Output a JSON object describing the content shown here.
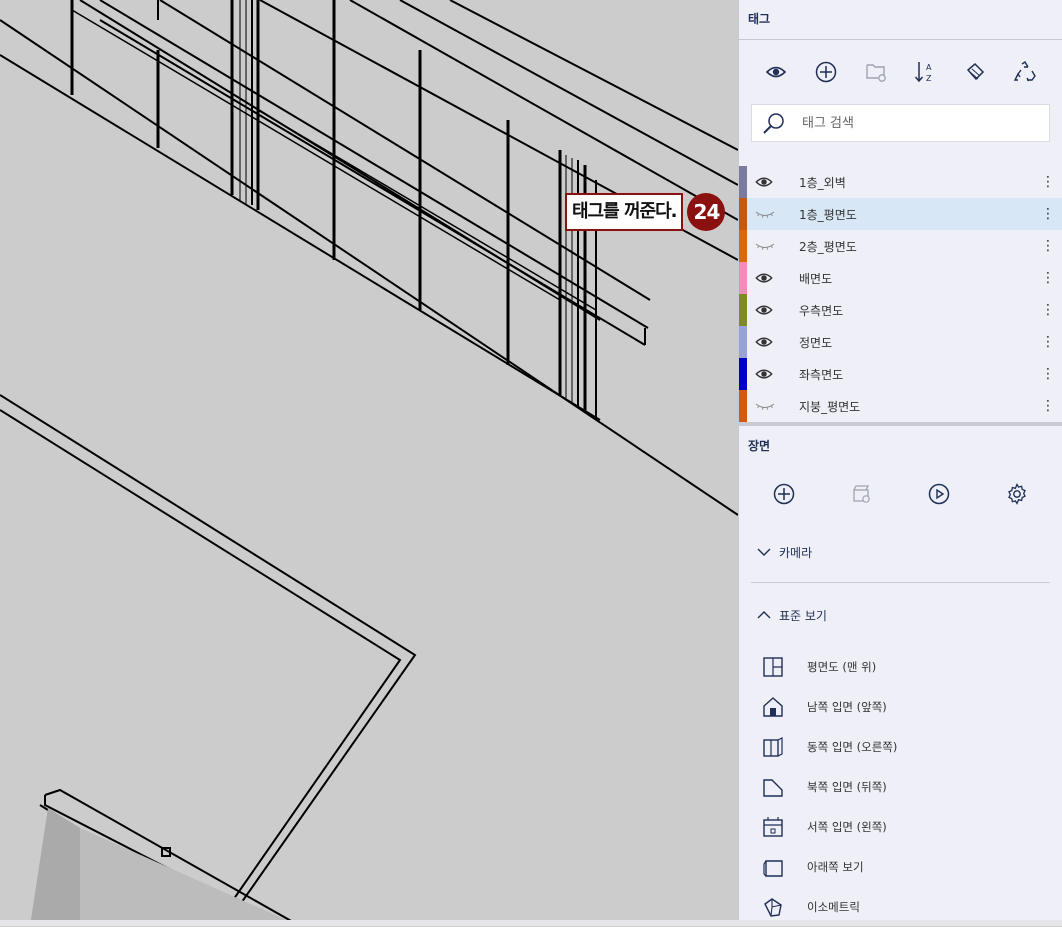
{
  "callout": {
    "text": "태그를 꺼준다.",
    "number": "24"
  },
  "panel": {
    "tags_header": "태그",
    "search_placeholder": "태그 검색",
    "tags": [
      {
        "label": "1층_외벽",
        "color": "#7b7b9e",
        "visible": true,
        "selected": false
      },
      {
        "label": "1층_평면도",
        "color": "#c25a12",
        "visible": false,
        "selected": true
      },
      {
        "label": "2층_평면도",
        "color": "#d76a10",
        "visible": false,
        "selected": false
      },
      {
        "label": "배면도",
        "color": "#f28bb5",
        "visible": true,
        "selected": false
      },
      {
        "label": "우측면도",
        "color": "#7f8a22",
        "visible": true,
        "selected": false
      },
      {
        "label": "정면도",
        "color": "#9aa0d8",
        "visible": true,
        "selected": false
      },
      {
        "label": "좌측면도",
        "color": "#0000c8",
        "visible": true,
        "selected": false
      },
      {
        "label": "지붕_평면도",
        "color": "#d05a10",
        "visible": false,
        "selected": false
      }
    ],
    "more_glyph": "⋮",
    "scenes_header": "장면",
    "camera_group": "카메라",
    "standard_group": "표준 보기",
    "standard_views": [
      {
        "label": "평면도 (맨 위)",
        "icon": "top-view-icon"
      },
      {
        "label": "남쪽 입면 (앞쪽)",
        "icon": "south-elevation-icon"
      },
      {
        "label": "동쪽 입면 (오른쪽)",
        "icon": "east-elevation-icon"
      },
      {
        "label": "북쪽 입면 (뒤쪽)",
        "icon": "north-elevation-icon"
      },
      {
        "label": "서쪽 입면 (왼쪽)",
        "icon": "west-elevation-icon"
      },
      {
        "label": "아래쪽 보기",
        "icon": "bottom-view-icon"
      },
      {
        "label": "이소메트릭",
        "icon": "isometric-icon"
      }
    ]
  }
}
